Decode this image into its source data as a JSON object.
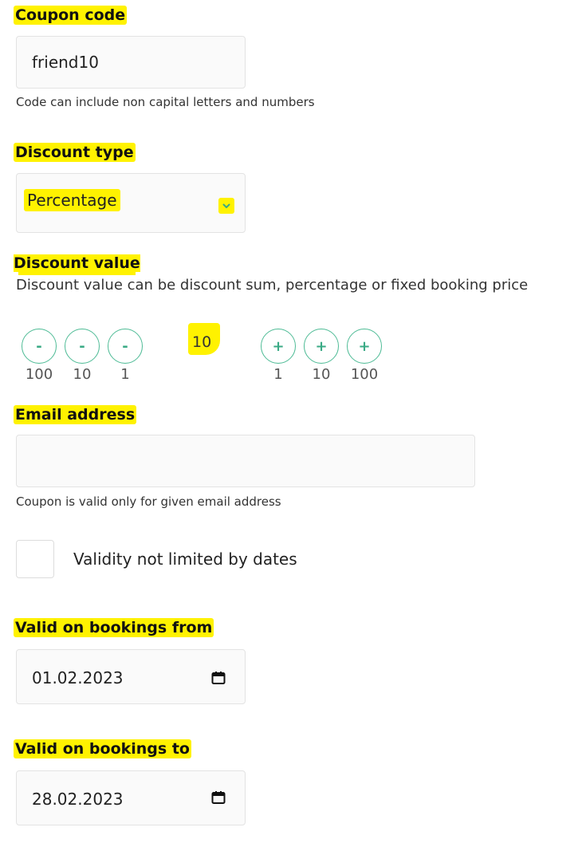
{
  "coupon": {
    "label": "Coupon code",
    "value": "friend10",
    "help": "Code can include non capital letters and numbers"
  },
  "discount_type": {
    "label": "Discount type",
    "value": "Percentage",
    "icon": "chevron-down-icon"
  },
  "discount_value": {
    "label": "Discount value",
    "description": "Discount value can be discount sum, percentage or fixed booking price",
    "value": "10",
    "minus_symbol": "-",
    "plus_symbol": "+",
    "minus_steps": [
      "100",
      "10",
      "1"
    ],
    "plus_steps": [
      "1",
      "10",
      "100"
    ],
    "accent_color": "#4dbb95"
  },
  "email": {
    "label": "Email address",
    "value": "",
    "help": "Coupon is valid only for given email address"
  },
  "validity": {
    "checkbox_label": "Validity not limited by dates",
    "checked": false
  },
  "valid_from": {
    "label": "Valid on bookings from",
    "value": "01.02.2023",
    "icon": "calendar-icon"
  },
  "valid_to": {
    "label": "Valid on bookings to",
    "value": "28.02.2023",
    "icon": "calendar-icon"
  },
  "highlight_color": "#fff200"
}
